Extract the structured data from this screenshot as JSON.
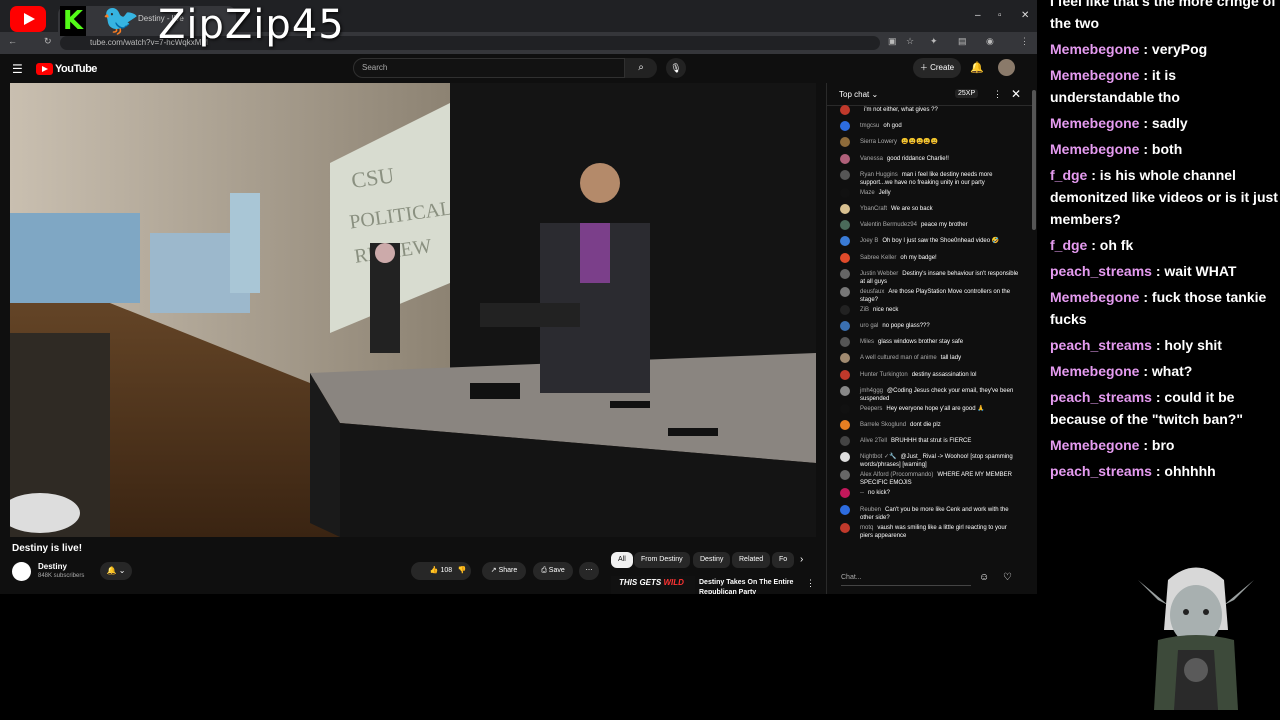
{
  "overlay": {
    "handle": "ZipZip45"
  },
  "browser": {
    "tab_title": "Destiny - live",
    "url": "tube.com/watch?v=7-hcWqkxMM"
  },
  "youtube": {
    "logo_text": "YouTube",
    "search_placeholder": "Search",
    "create_label": "Create",
    "video_title": "Destiny is live!",
    "channel_name": "Destiny",
    "subscribers": "848K subscribers",
    "likes": "108",
    "share_label": "Share",
    "save_label": "Save",
    "chips": [
      "All",
      "From Destiny",
      "Destiny",
      "Related",
      "Fo"
    ],
    "rec_thumb_text": "THIS GETS",
    "rec_thumb_accent": "WILD",
    "rec_title": "Destiny Takes On The Entire Republican Party"
  },
  "live_chat": {
    "header": "Top chat",
    "xp": "25XP",
    "input_placeholder": "Chat...",
    "messages": [
      {
        "author": "",
        "text": "i'm not either, what gives ??",
        "color": "#c0392b"
      },
      {
        "author": "tmgcsu",
        "text": "oh god",
        "color": "#2d6cdf"
      },
      {
        "author": "Sierra Lowery",
        "text": "😩😩😩😩😩",
        "color": "#8e6b3a"
      },
      {
        "author": "Vanessa",
        "text": "good riddance Charlie!!",
        "color": "#b0607a"
      },
      {
        "author": "Ryan Huggins",
        "text": "man i feel like destiny needs more support...we have no freaking unity in our party",
        "color": "#555"
      },
      {
        "author": "Maze",
        "text": "Jelly",
        "color": "#111"
      },
      {
        "author": "YbanCraft",
        "text": "We are so back",
        "color": "#d8c090"
      },
      {
        "author": "Valentin Bermudez94",
        "text": "peace my brother",
        "color": "#4a6a5a"
      },
      {
        "author": "Joey B",
        "text": "Oh boy I just saw the Shoe0nhead video 🤣",
        "color": "#3a7bd5"
      },
      {
        "author": "Sabree Keller",
        "text": "oh my badge!",
        "color": "#e04a2a"
      },
      {
        "author": "Justin Webber",
        "text": "Destiny's insane behaviour isn't responsible at all guys",
        "color": "#666"
      },
      {
        "author": "deusfaux",
        "text": "Are those PlayStation Move controllers on the stage?",
        "color": "#777"
      },
      {
        "author": "ZiB",
        "text": "nice neck",
        "color": "#222"
      },
      {
        "author": "uro gal",
        "text": "no pope glass???",
        "color": "#3a6fb0"
      },
      {
        "author": "Miles",
        "text": "glass windows brother stay safe",
        "color": "#555"
      },
      {
        "author": "A well cultured man of anime",
        "text": "tall lady",
        "color": "#a08a70"
      },
      {
        "author": "Hunter Turkington",
        "text": "destiny assassination lol",
        "color": "#c0392b"
      },
      {
        "author": "jmh4ggg",
        "text": "@Coding Jesus check your email, they've been suspended",
        "color": "#888"
      },
      {
        "author": "Peepers",
        "text": "Hey everyone hope y'all are good 🙏",
        "color": "#111"
      },
      {
        "author": "Barrele Skoglund",
        "text": "dont die plz",
        "color": "#e67e22"
      },
      {
        "author": "Alive 2Tell",
        "text": "BRUHHH that strut is FIERCE",
        "color": "#444"
      },
      {
        "author": "Nightbot ✓🔧",
        "text": "@Just_ Rival -> Woohoo! [stop spamming words/phrases] [warning]",
        "color": "#ddd"
      },
      {
        "author": "Alex Alford (Procommando)",
        "text": "WHERE ARE MY MEMBER SPECIFIC EMOJIS",
        "color": "#666"
      },
      {
        "author": "--",
        "text": "no kick?",
        "color": "#c2185b"
      },
      {
        "author": "Reuben",
        "text": "Can't you be more like Cenk and work with the other side?",
        "color": "#2d6cdf"
      },
      {
        "author": "motq",
        "text": "vaush was smiling like a little girl reacting to your piers appearence",
        "color": "#c0392b"
      }
    ]
  },
  "stream_chat": {
    "lines": [
      {
        "user": "",
        "text": "I feel like that's the more cringe of the two",
        "user_color": "#ffffff"
      },
      {
        "user": "Memebegone",
        "text": "veryPog",
        "user_color": "#e59bf0"
      },
      {
        "user": "Memebegone",
        "text": "it is understandable tho",
        "user_color": "#e59bf0"
      },
      {
        "user": "Memebegone",
        "text": "sadly",
        "user_color": "#e59bf0"
      },
      {
        "user": "Memebegone",
        "text": "both",
        "user_color": "#e59bf0"
      },
      {
        "user": "f_dge",
        "text": "is his whole channel demonitzed like videos or is it just members?",
        "user_color": "#e59bf0"
      },
      {
        "user": "f_dge",
        "text": "oh fk",
        "user_color": "#e59bf0"
      },
      {
        "user": "peach_streams",
        "text": "wait WHAT",
        "user_color": "#e59bf0"
      },
      {
        "user": "Memebegone",
        "text": "fuck those tankie fucks",
        "user_color": "#e59bf0"
      },
      {
        "user": "peach_streams",
        "text": "holy shit",
        "user_color": "#e59bf0"
      },
      {
        "user": "Memebegone",
        "text": "what?",
        "user_color": "#e59bf0"
      },
      {
        "user": "peach_streams",
        "text": "could it be because of the \"twitch ban?\"",
        "user_color": "#e59bf0"
      },
      {
        "user": "Memebegone",
        "text": "bro",
        "user_color": "#e59bf0"
      },
      {
        "user": "peach_streams",
        "text": "ohhhhh",
        "user_color": "#e59bf0"
      }
    ]
  }
}
